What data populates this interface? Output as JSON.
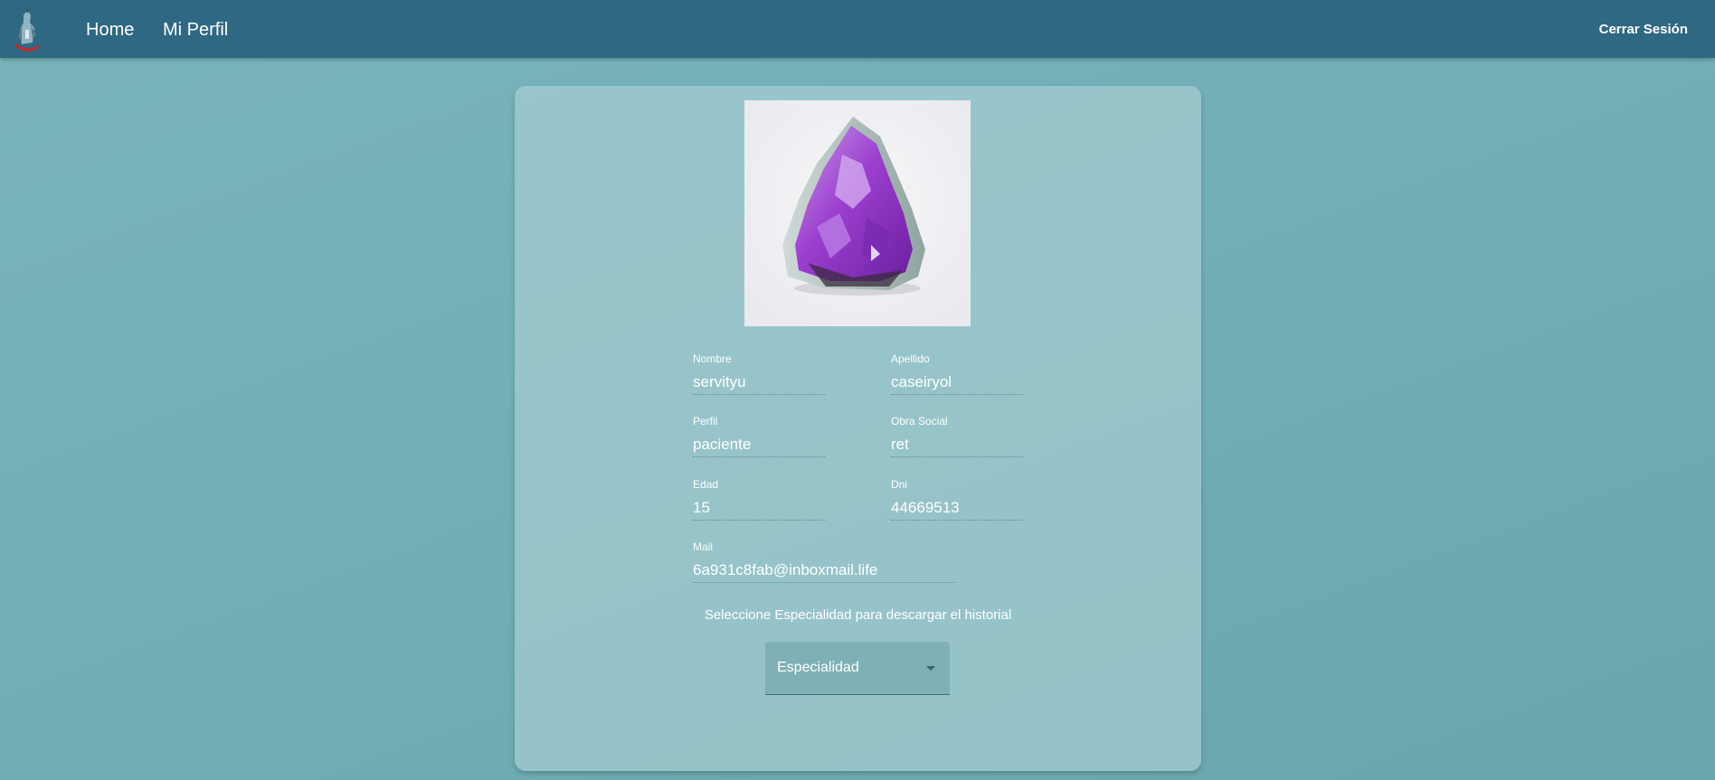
{
  "navbar": {
    "home_label": "Home",
    "profile_label": "Mi Perfil",
    "logout_label": "Cerrar Sesión"
  },
  "profile": {
    "fields": {
      "nombre": {
        "label": "Nombre",
        "value": "servityu"
      },
      "apellido": {
        "label": "Apellido",
        "value": "caseiryol"
      },
      "perfil": {
        "label": "Perfil",
        "value": "paciente"
      },
      "obra_social": {
        "label": "Obra Social",
        "value": "ret"
      },
      "edad": {
        "label": "Edad",
        "value": "15"
      },
      "dni": {
        "label": "Dni",
        "value": "44669513"
      },
      "mail": {
        "label": "Mail",
        "value": "6a931c8fab@inboxmail.life"
      }
    },
    "photo_subject": "amethyst-crystal"
  },
  "history": {
    "hint": "Seleccione Especialidad para descargar el historial",
    "select_placeholder": "Especialidad"
  },
  "colors": {
    "navbar": "#2f6882",
    "background": "#72aeb5",
    "card": "#a6cbcf"
  }
}
